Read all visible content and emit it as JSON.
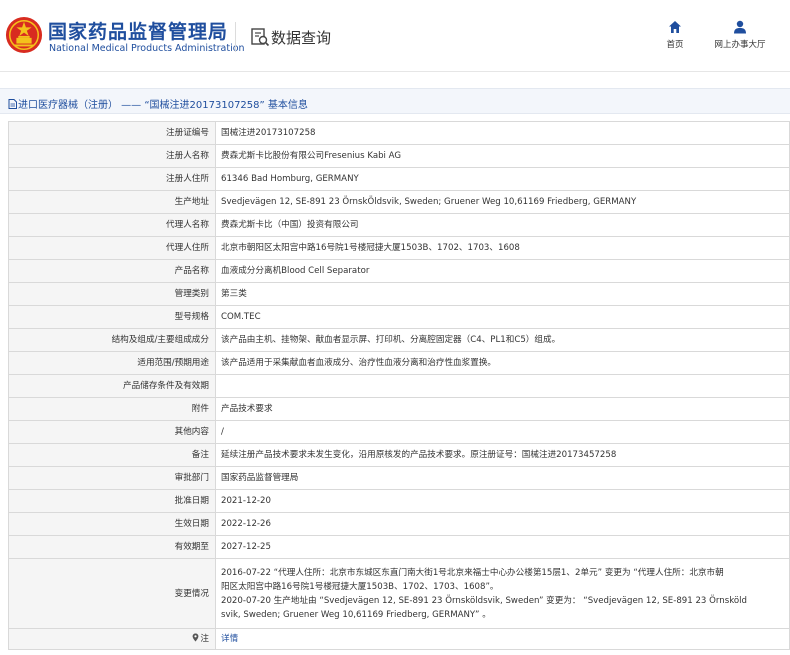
{
  "header": {
    "brand_cn": "国家药品监督管理局",
    "brand_en": "National Medical Products Administration",
    "query_title": "数据查询",
    "nav": [
      {
        "label": "首页",
        "icon": "home-icon"
      },
      {
        "label": "网上办事大厅",
        "icon": "user-icon"
      }
    ]
  },
  "breadcrumb": {
    "text": "进口医疗器械（注册） —— “国械注进20173107258” 基本信息"
  },
  "table": {
    "rows": [
      {
        "label": "注册证编号",
        "value": "国械注进20173107258"
      },
      {
        "label": "注册人名称",
        "value": "费森尤斯卡比股份有限公司Fresenius Kabi AG"
      },
      {
        "label": "注册人住所",
        "value": "61346 Bad Homburg, GERMANY"
      },
      {
        "label": "生产地址",
        "value": "Svedjevägen 12, SE-891 23 ÖrnskÖldsvik, Sweden; Gruener Weg 10,61169 Friedberg, GERMANY"
      },
      {
        "label": "代理人名称",
        "value": "费森尤斯卡比（中国）投资有限公司"
      },
      {
        "label": "代理人住所",
        "value": "北京市朝阳区太阳宫中路16号院1号楼冠捷大厦1503B、1702、1703、1608"
      },
      {
        "label": "产品名称",
        "value": "血液成分分离机Blood Cell Separator"
      },
      {
        "label": "管理类别",
        "value": "第三类"
      },
      {
        "label": "型号规格",
        "value": "COM.TEC"
      },
      {
        "label": "结构及组成/主要组成成分",
        "value": "该产品由主机、挂物架、献血者显示屏、打印机、分离腔固定器（C4、PL1和C5）组成。"
      },
      {
        "label": "适用范围/预期用途",
        "value": "该产品适用于采集献血者血液成分、治疗性血液分离和治疗性血浆置换。"
      },
      {
        "label": "产品储存条件及有效期",
        "value": ""
      },
      {
        "label": "附件",
        "value": "产品技术要求"
      },
      {
        "label": "其他内容",
        "value": "/"
      },
      {
        "label": "备注",
        "value": "延续注册产品技术要求未发生变化，沿用原核发的产品技术要求。原注册证号：国械注进20173457258"
      },
      {
        "label": "审批部门",
        "value": "国家药品监督管理局"
      },
      {
        "label": "批准日期",
        "value": "2021-12-20"
      },
      {
        "label": "生效日期",
        "value": "2022-12-26"
      },
      {
        "label": "有效期至",
        "value": "2027-12-25"
      }
    ],
    "changes": {
      "label": "变更情况",
      "lines": [
        "2016-07-22 “代理人住所：北京市东城区东直门南大街1号北京来福士中心办公楼第15层1、2单元” 变更为 “代理人住所：北京市朝",
        "阳区太阳宫中路16号院1号楼冠捷大厦1503B、1702、1703、1608”。",
        "2020-07-20 生产地址由 “Svedjevägen 12, SE-891 23 Örnsköldsvik, Sweden” 变更为： “Svedjevägen 12, SE-891 23 Örnsköld",
        "svik, Sweden; Gruener Weg 10,61169 Friedberg, GERMANY” 。"
      ]
    },
    "note": {
      "label": "注",
      "link": "详情"
    }
  },
  "colors": {
    "brand_blue": "#1f4e9e",
    "label_bg": "#f5f5f5",
    "border": "#d9d9d9"
  }
}
